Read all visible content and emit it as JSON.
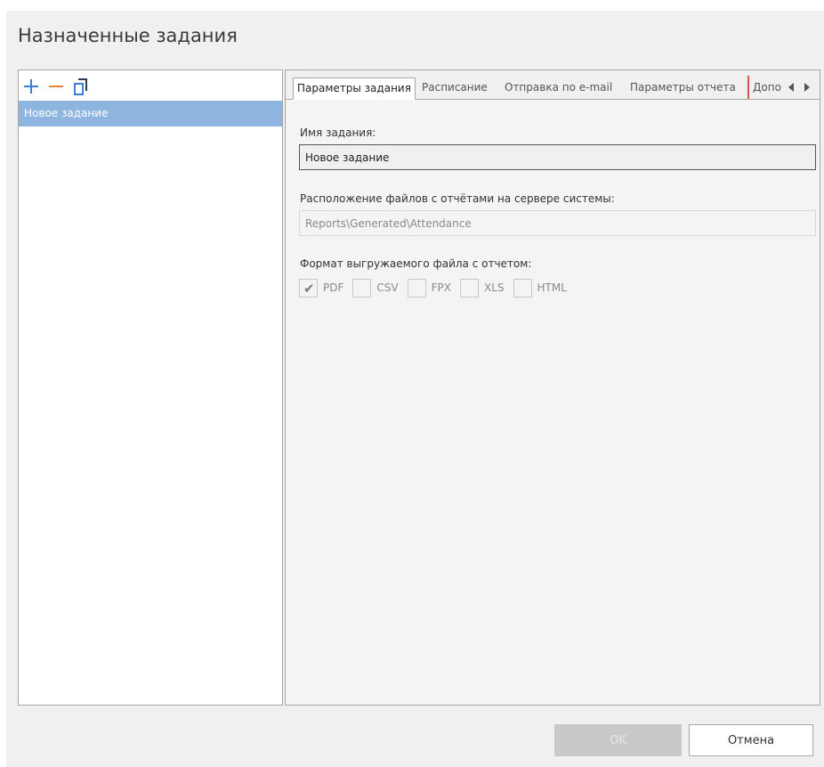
{
  "dialog": {
    "title": "Назначенные задания"
  },
  "toolbar": {
    "add_icon": "plus-icon",
    "remove_icon": "minus-icon",
    "copy_icon": "copy-icon",
    "colors": {
      "add": "#3a7fd5",
      "remove": "#e8833a"
    }
  },
  "task_list": {
    "items": [
      {
        "label": "Новое задание",
        "selected": true
      }
    ],
    "selected_color": "#8db5e0"
  },
  "tabs": [
    {
      "label": "Параметры задания",
      "active": true
    },
    {
      "label": "Расписание",
      "active": false
    },
    {
      "label": "Отправка по e-mail",
      "active": false
    },
    {
      "label": "Параметры отчета",
      "active": false
    },
    {
      "label": "Допо",
      "active": false
    }
  ],
  "tab_scroll": {
    "left_icon": "scroll-left-icon",
    "right_icon": "scroll-right-icon"
  },
  "params": {
    "name_label": "Имя задания:",
    "name_value": "Новое задание",
    "path_label": "Расположение файлов с отчётами на сервере системы:",
    "path_value": "Reports\\Generated\\Attendance",
    "format_label": "Формат выгружаемого файла с отчетом:",
    "formats": [
      {
        "label": "PDF",
        "checked": true
      },
      {
        "label": "CSV",
        "checked": false
      },
      {
        "label": "FPX",
        "checked": false
      },
      {
        "label": "XLS",
        "checked": false
      },
      {
        "label": "HTML",
        "checked": false
      }
    ]
  },
  "footer": {
    "ok_label": "OK",
    "cancel_label": "Отмена"
  }
}
